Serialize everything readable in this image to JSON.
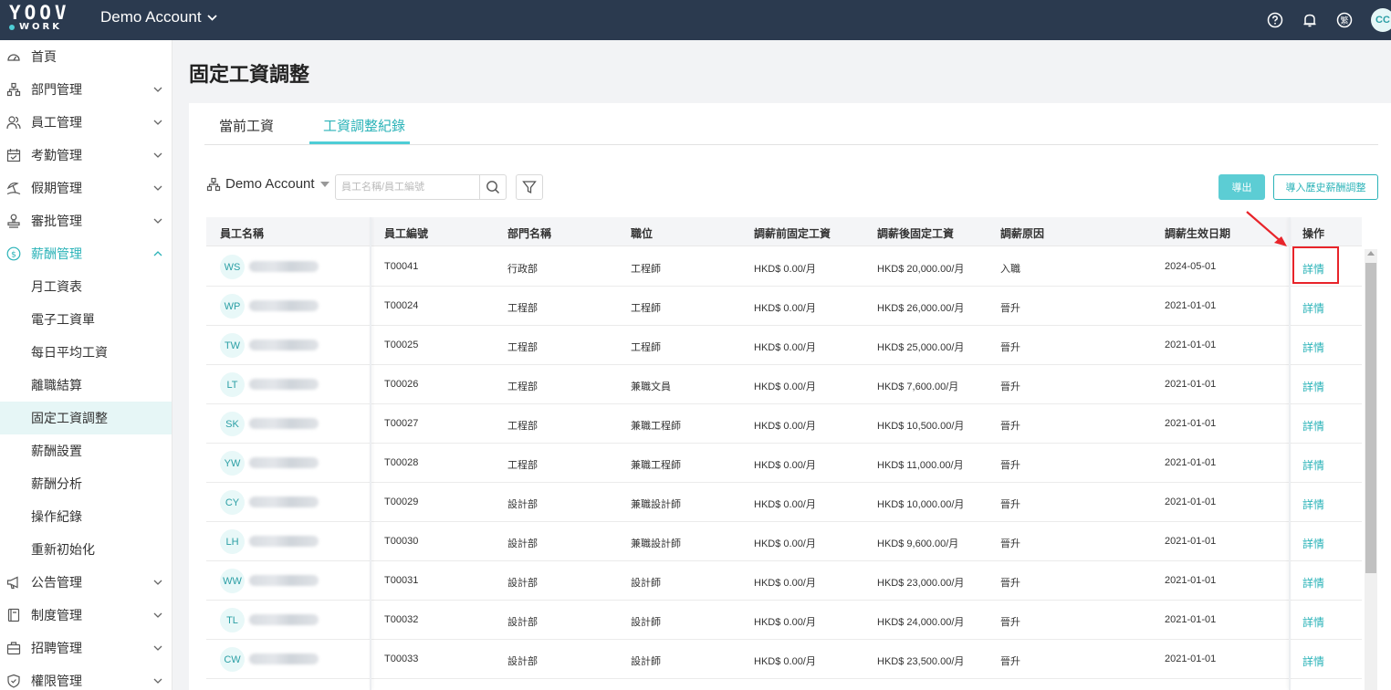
{
  "topbar": {
    "logo_top": "YOOV",
    "logo_bottom": "WORK",
    "account": "Demo Account",
    "avatar": "CC"
  },
  "sidebar": {
    "items": [
      {
        "label": "首頁",
        "icon": "dashboard-icon",
        "has_children": false
      },
      {
        "label": "部門管理",
        "icon": "org-chart-icon",
        "has_children": true
      },
      {
        "label": "員工管理",
        "icon": "users-icon",
        "has_children": true
      },
      {
        "label": "考勤管理",
        "icon": "calendar-check-icon",
        "has_children": true
      },
      {
        "label": "假期管理",
        "icon": "beach-icon",
        "has_children": true
      },
      {
        "label": "審批管理",
        "icon": "stamp-icon",
        "has_children": true
      },
      {
        "label": "薪酬管理",
        "icon": "dollar-icon",
        "has_children": true,
        "expanded": true
      }
    ],
    "sub_items": [
      "月工資表",
      "電子工資單",
      "每日平均工資",
      "離職結算",
      "固定工資調整",
      "薪酬設置",
      "薪酬分析",
      "操作紀錄",
      "重新初始化"
    ],
    "active_sub": "固定工資調整",
    "bottom_items": [
      {
        "label": "公告管理",
        "icon": "megaphone-icon"
      },
      {
        "label": "制度管理",
        "icon": "book-icon"
      },
      {
        "label": "招聘管理",
        "icon": "briefcase-icon"
      },
      {
        "label": "權限管理",
        "icon": "shield-icon"
      }
    ]
  },
  "page": {
    "title": "固定工資調整",
    "tabs": [
      "當前工資",
      "工資調整紀錄"
    ],
    "active_tab": "工資調整紀錄"
  },
  "toolbar": {
    "org_select": "Demo Account",
    "search_placeholder": "員工名稱/員工編號",
    "export_label": "導出",
    "import_label": "導入歷史薪酬調整"
  },
  "table": {
    "columns": [
      "員工名稱",
      "員工編號",
      "部門名稱",
      "職位",
      "調薪前固定工資",
      "調薪後固定工資",
      "調薪原因",
      "調薪生效日期",
      "操作"
    ],
    "rows": [
      {
        "initials": "WS",
        "id": "T00041",
        "dept": "行政部",
        "position": "工程師",
        "before": "HKD$ 0.00/月",
        "after": "HKD$ 20,000.00/月",
        "reason": "入職",
        "date": "2024-05-01",
        "action": "詳情"
      },
      {
        "initials": "WP",
        "id": "T00024",
        "dept": "工程部",
        "position": "工程師",
        "before": "HKD$ 0.00/月",
        "after": "HKD$ 26,000.00/月",
        "reason": "晉升",
        "date": "2021-01-01",
        "action": "詳情"
      },
      {
        "initials": "TW",
        "id": "T00025",
        "dept": "工程部",
        "position": "工程師",
        "before": "HKD$ 0.00/月",
        "after": "HKD$ 25,000.00/月",
        "reason": "晉升",
        "date": "2021-01-01",
        "action": "詳情"
      },
      {
        "initials": "LT",
        "id": "T00026",
        "dept": "工程部",
        "position": "兼職文員",
        "before": "HKD$ 0.00/月",
        "after": "HKD$ 7,600.00/月",
        "reason": "晉升",
        "date": "2021-01-01",
        "action": "詳情"
      },
      {
        "initials": "SK",
        "id": "T00027",
        "dept": "工程部",
        "position": "兼職工程師",
        "before": "HKD$ 0.00/月",
        "after": "HKD$ 10,500.00/月",
        "reason": "晉升",
        "date": "2021-01-01",
        "action": "詳情"
      },
      {
        "initials": "YW",
        "id": "T00028",
        "dept": "工程部",
        "position": "兼職工程師",
        "before": "HKD$ 0.00/月",
        "after": "HKD$ 11,000.00/月",
        "reason": "晉升",
        "date": "2021-01-01",
        "action": "詳情"
      },
      {
        "initials": "CY",
        "id": "T00029",
        "dept": "設計部",
        "position": "兼職設計師",
        "before": "HKD$ 0.00/月",
        "after": "HKD$ 10,000.00/月",
        "reason": "晉升",
        "date": "2021-01-01",
        "action": "詳情"
      },
      {
        "initials": "LH",
        "id": "T00030",
        "dept": "設計部",
        "position": "兼職設計師",
        "before": "HKD$ 0.00/月",
        "after": "HKD$ 9,600.00/月",
        "reason": "晉升",
        "date": "2021-01-01",
        "action": "詳情"
      },
      {
        "initials": "WW",
        "id": "T00031",
        "dept": "設計部",
        "position": "設計師",
        "before": "HKD$ 0.00/月",
        "after": "HKD$ 23,000.00/月",
        "reason": "晉升",
        "date": "2021-01-01",
        "action": "詳情"
      },
      {
        "initials": "TL",
        "id": "T00032",
        "dept": "設計部",
        "position": "設計師",
        "before": "HKD$ 0.00/月",
        "after": "HKD$ 24,000.00/月",
        "reason": "晉升",
        "date": "2021-01-01",
        "action": "詳情"
      },
      {
        "initials": "CW",
        "id": "T00033",
        "dept": "設計部",
        "position": "設計師",
        "before": "HKD$ 0.00/月",
        "after": "HKD$ 23,500.00/月",
        "reason": "晉升",
        "date": "2021-01-01",
        "action": "詳情"
      }
    ]
  },
  "colors": {
    "topbar": "#2b3a4f",
    "accent": "#2bb3b8",
    "export_button": "#5ccdd4",
    "annotation": "#e8242a"
  }
}
